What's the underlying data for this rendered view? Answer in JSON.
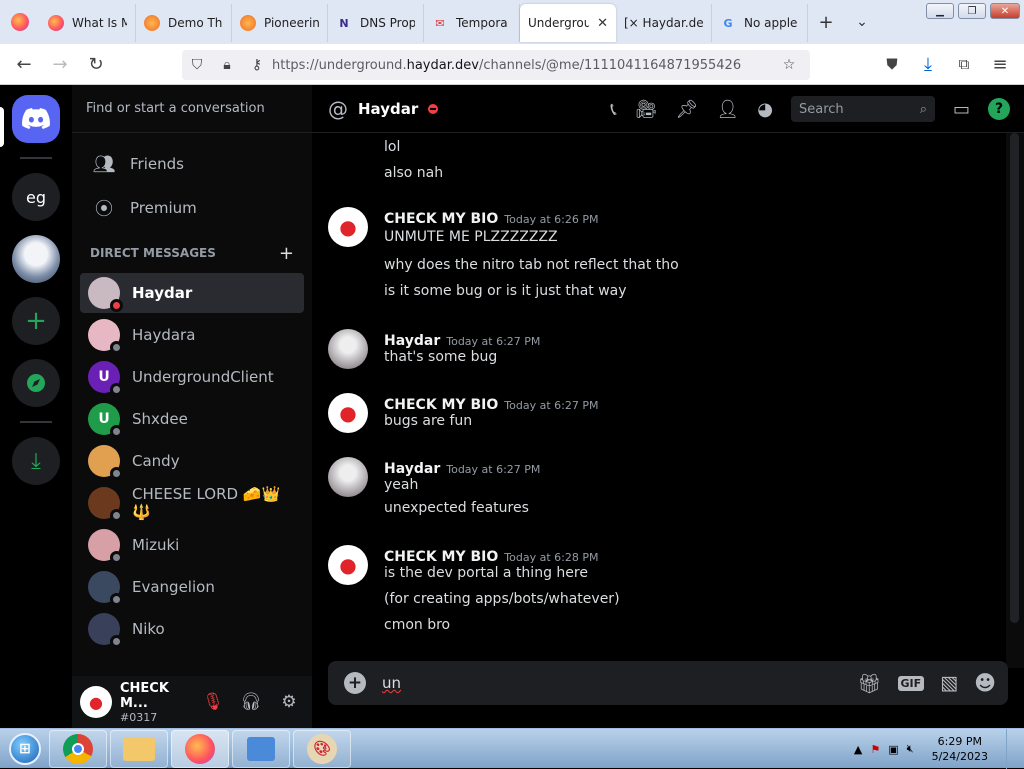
{
  "browser": {
    "tabs": [
      {
        "label": "What Is My IP",
        "icon": "firefox-icon"
      },
      {
        "label": "Demo Th",
        "icon": "orange-circle-icon"
      },
      {
        "label": "Pioneerin",
        "icon": "orange-circle-icon"
      },
      {
        "label": "DNS Prop",
        "icon": "n-logo-icon"
      },
      {
        "label": "Tempora",
        "icon": "mail-icon"
      },
      {
        "label": "Undergrou",
        "icon": "",
        "active": true
      },
      {
        "label": "[× Haydar.de",
        "icon": ""
      },
      {
        "label": "No apple",
        "icon": "google-icon"
      }
    ],
    "url_prefix": "https://underground.",
    "url_domain": "haydar.dev",
    "url_path": "/channels/@me/1111041164871955426"
  },
  "sidebar": {
    "search_placeholder": "Find or start a conversation",
    "nav": [
      {
        "label": "Friends"
      },
      {
        "label": "Premium"
      }
    ],
    "dm_header": "DIRECT MESSAGES",
    "dms": [
      {
        "name": "Haydar",
        "status": "dnd",
        "color": "#c9b9c0",
        "initial": "",
        "active": true
      },
      {
        "name": "Haydara",
        "status": "offline",
        "color": "#e8b7c4",
        "initial": ""
      },
      {
        "name": "UndergroundClient",
        "status": "offline",
        "color": "#6a1fb5",
        "initial": "U"
      },
      {
        "name": "Shxdee",
        "status": "offline",
        "color": "#1f9c4a",
        "initial": "U"
      },
      {
        "name": "Candy",
        "status": "offline",
        "color": "#e0a050",
        "initial": ""
      },
      {
        "name": "CHEESE LORD 🧀👑🔱",
        "status": "offline",
        "color": "#6b3a1e",
        "initial": ""
      },
      {
        "name": "Mizuki",
        "status": "offline",
        "color": "#d6a0a6",
        "initial": ""
      },
      {
        "name": "Evangelion",
        "status": "offline",
        "color": "#3a4860",
        "initial": ""
      },
      {
        "name": "Niko",
        "status": "offline",
        "color": "#39405a",
        "initial": ""
      }
    ],
    "user": {
      "name": "CHECK M...",
      "tag": "#0317"
    }
  },
  "guilds": [
    {
      "label": "eg"
    }
  ],
  "chat": {
    "channel_name": "Haydar",
    "search_placeholder": "Search",
    "messages": [
      {
        "continuation": true,
        "lines": [
          "lol",
          "also nah"
        ]
      },
      {
        "author": "CHECK MY BIO",
        "time": "Today at 6:26 PM",
        "avatar": "apple",
        "lines": [
          "UNMUTE ME PLZZZZZZZ",
          "why does the nitro tab not reflect that tho",
          "is it some bug or is it just that way"
        ]
      },
      {
        "author": "Haydar",
        "time": "Today at 6:27 PM",
        "avatar": "haydar",
        "lines": [
          "that's some bug"
        ]
      },
      {
        "author": "CHECK MY BIO",
        "time": "Today at 6:27 PM",
        "avatar": "apple",
        "lines": [
          "bugs are fun"
        ]
      },
      {
        "author": "Haydar",
        "time": "Today at 6:27 PM",
        "avatar": "haydar",
        "lines": [
          "yeah",
          "unexpected features"
        ]
      },
      {
        "author": "CHECK MY BIO",
        "time": "Today at 6:28 PM",
        "avatar": "apple",
        "lines": [
          "is the dev portal a thing here",
          "(for creating apps/bots/whatever)",
          "cmon bro"
        ]
      }
    ],
    "composer_text": "un"
  },
  "taskbar": {
    "time": "6:29 PM",
    "date": "5/24/2023"
  }
}
